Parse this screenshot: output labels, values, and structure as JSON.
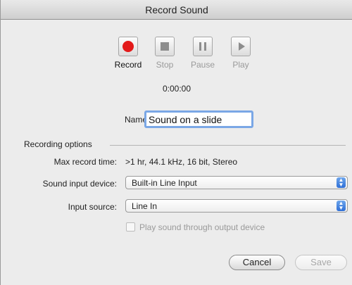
{
  "window": {
    "title": "Record Sound"
  },
  "controls": {
    "record_label": "Record",
    "stop_label": "Stop",
    "pause_label": "Pause",
    "play_label": "Play",
    "time": "0:00:00"
  },
  "name": {
    "label": "Name:",
    "value": "Sound on a slide"
  },
  "options": {
    "group_label": "Recording options",
    "max_time_label": "Max record time:",
    "max_time_value": ">1 hr, 44.1 kHz, 16 bit, Stereo",
    "input_device_label": "Sound input device:",
    "input_device_value": "Built-in Line Input",
    "input_source_label": "Input source:",
    "input_source_value": "Line In",
    "play_through_label": "Play sound through output device",
    "play_through_checked": false
  },
  "buttons": {
    "cancel": "Cancel",
    "save": "Save"
  },
  "colors": {
    "record": "#e31a1a",
    "focus_ring": "#7aa7e6",
    "select_arrows": "#2f6fd6"
  }
}
